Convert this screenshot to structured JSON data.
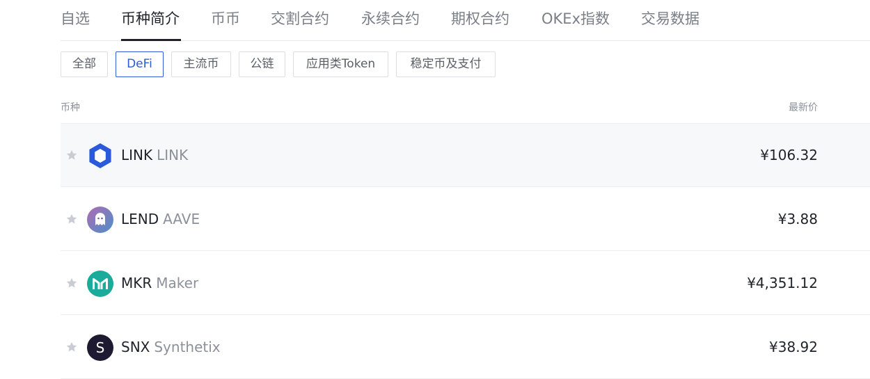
{
  "tabs": [
    {
      "label": "自选"
    },
    {
      "label": "币种简介"
    },
    {
      "label": "币币"
    },
    {
      "label": "交割合约"
    },
    {
      "label": "永续合约"
    },
    {
      "label": "期权合约"
    },
    {
      "label": "OKEx指数"
    },
    {
      "label": "交易数据"
    }
  ],
  "active_tab": "币种简介",
  "filters": [
    {
      "label": "全部"
    },
    {
      "label": "DeFi"
    },
    {
      "label": "主流币"
    },
    {
      "label": "公链"
    },
    {
      "label": "应用类Token"
    },
    {
      "label": "稳定币及支付"
    }
  ],
  "active_filter": "DeFi",
  "table": {
    "headers": {
      "coin": "币种",
      "price": "最新价"
    },
    "rows": [
      {
        "symbol": "LINK",
        "name": "LINK",
        "price": "¥106.32",
        "icon": "chainlink-icon",
        "icon_color": "#2a5ada"
      },
      {
        "symbol": "LEND",
        "name": "AAVE",
        "price": "¥3.88",
        "icon": "aave-ghost-icon",
        "icon_color": "#8a6fd1"
      },
      {
        "symbol": "MKR",
        "name": "Maker",
        "price": "¥4,351.12",
        "icon": "maker-icon",
        "icon_color": "#1aab9b"
      },
      {
        "symbol": "SNX",
        "name": "Synthetix",
        "price": "¥38.92",
        "icon": "synthetix-icon",
        "icon_color": "#1e1a31"
      }
    ]
  },
  "colors": {
    "accent": "#2e5bd6",
    "text": "#1f2329",
    "muted": "#8b9099",
    "row_hover": "#f7f8fa"
  }
}
